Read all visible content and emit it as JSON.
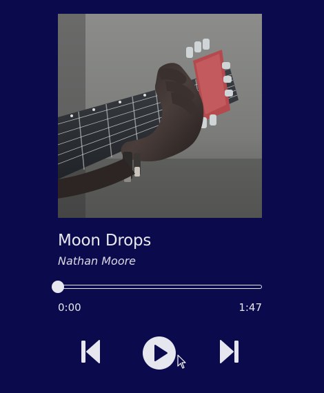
{
  "colors": {
    "background": "#0b0a4c",
    "foreground": "#e6e6ee"
  },
  "track": {
    "title": "Moon Drops",
    "artist": "Nathan Moore",
    "cover_description": "hand playing guitar"
  },
  "playback": {
    "current_time": "0:00",
    "total_time": "1:47",
    "progress_fraction": 0.0,
    "state": "paused"
  },
  "icons": {
    "previous": "skip-previous-icon",
    "play": "play-icon",
    "next": "skip-next-icon"
  }
}
